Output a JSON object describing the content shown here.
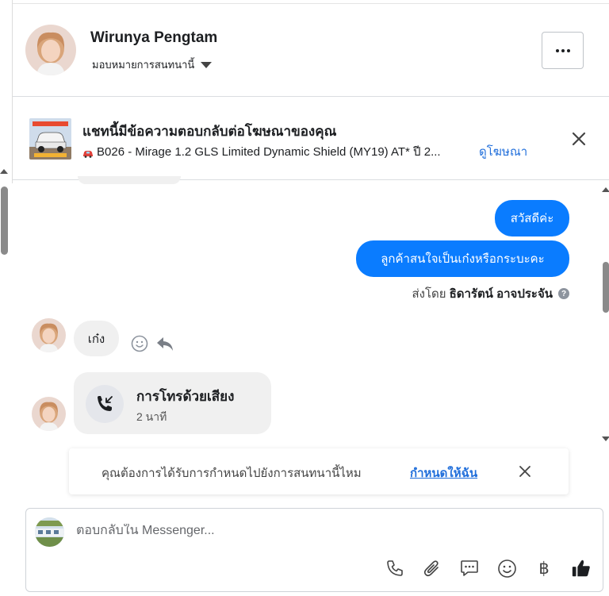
{
  "header": {
    "contact_name": "Wirunya Pengtam",
    "assign_label": "มอบหมายการสนทนานี้"
  },
  "ad": {
    "title": "แชทนี้มีข้อความตอบกลับต่อโฆษณาของคุณ",
    "description": "B026 - Mirage 1.2 GLS Limited Dynamic Shield (MY19) AT* ปี 2...",
    "view_link": "ดูโฆษณา"
  },
  "messages": {
    "outgoing": [
      "สวัสดีค่ะ",
      "ลูกค้าสนใจเป็นเก๋งหรือกระบะคะ"
    ],
    "sent_by_prefix": "ส่งโดย",
    "sent_by_name": "ธิดารัตน์ อาจประจัน",
    "incoming": "เก๋ง",
    "call": {
      "title": "การโทรด้วยเสียง",
      "duration": "2 นาที"
    }
  },
  "assign_prompt": {
    "text": "คุณต้องการได้รับการกำหนดไปยังการสนทนานี้ไหม",
    "link": "กำหนดให้ฉัน"
  },
  "composer": {
    "placeholder": "ตอบกลับใน Messenger...",
    "tools": [
      "phone-icon",
      "attachment-icon",
      "saved-reply-icon",
      "emoji-icon",
      "baht-icon",
      "like-icon"
    ],
    "baht_symbol": "฿"
  },
  "colors": {
    "accent": "#0a7cff",
    "link": "#216fdb"
  }
}
